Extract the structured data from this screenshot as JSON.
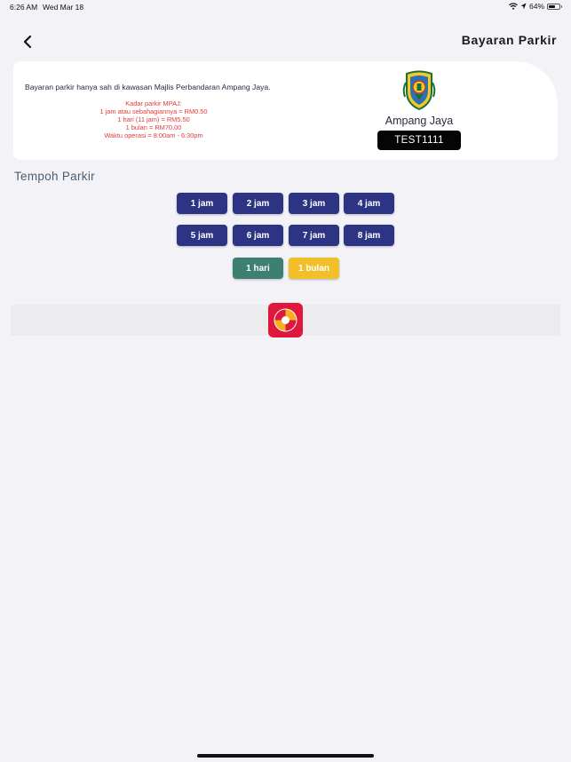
{
  "status": {
    "time": "6:26 AM",
    "date": "Wed Mar 18",
    "battery": "64%",
    "battery_fraction": 0.64
  },
  "nav": {
    "title": "Bayaran Parkir"
  },
  "info": {
    "message": "Bayaran parkir hanya sah di kawasan Majlis Perbandaran Ampang Jaya.",
    "rates": [
      "Kadar parkir MPAJ:",
      "1 jam atau sebahagiannya = RM0.50",
      "1 hari (11 jam) = RM5.50",
      "1 bulan = RM70.00",
      "Waktu operasi = 8:00am - 6:30pm"
    ],
    "council_name": "Ampang Jaya",
    "plate": "TEST1111"
  },
  "section": {
    "title": "Tempoh Parkir"
  },
  "durations": {
    "hours": [
      "1 jam",
      "2 jam",
      "3 jam",
      "4 jam",
      "5 jam",
      "6 jam",
      "7 jam",
      "8 jam"
    ],
    "day": "1 hari",
    "month": "1 bulan"
  },
  "colors": {
    "button": "#2d3484",
    "day_button": "#3d7f71",
    "month_button": "#f0bf2a",
    "rates_text": "#e23b3b",
    "payment_logo": "#e0173d"
  },
  "icons": {
    "back": "chevron-left-icon",
    "wifi": "wifi-icon",
    "location": "location-arrow-icon",
    "battery": "battery-icon",
    "crest": "council-crest-icon",
    "payment": "payment-logo-icon"
  }
}
